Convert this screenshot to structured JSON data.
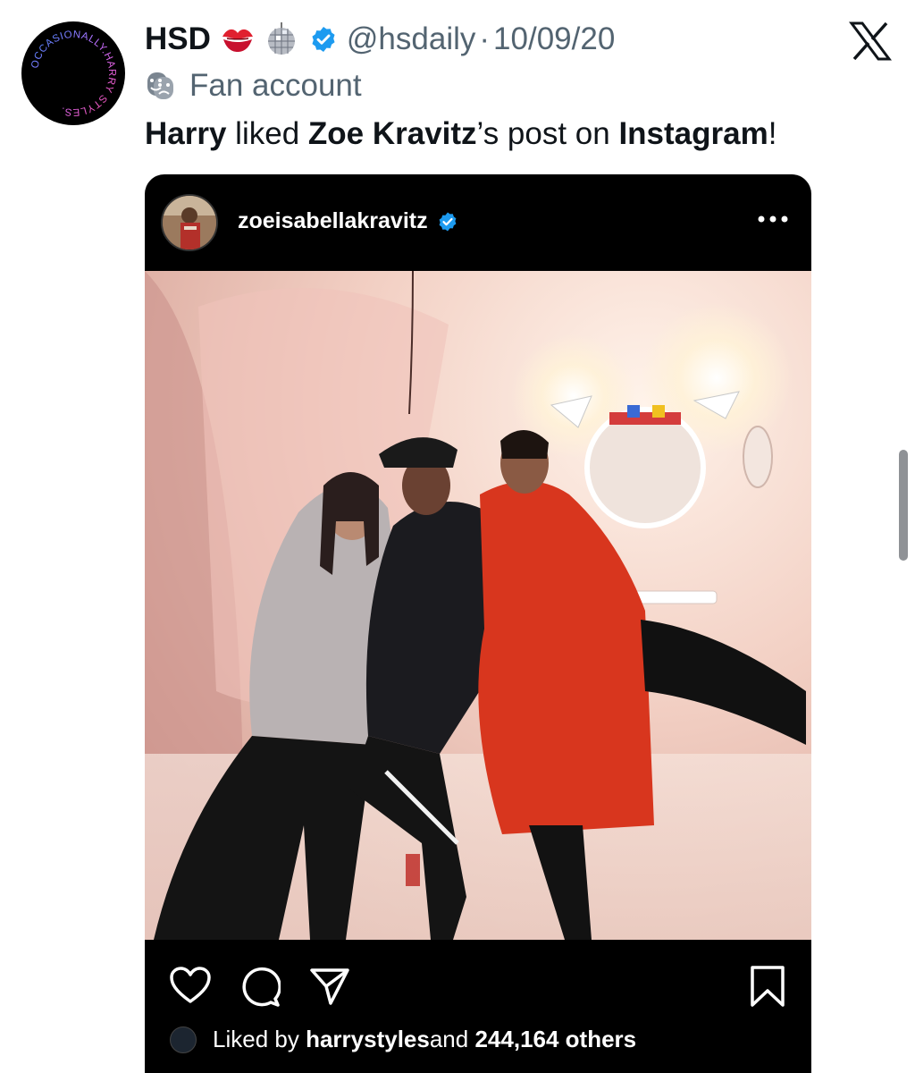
{
  "tweet": {
    "display_name": "HSD",
    "handle": "@hsdaily",
    "separator": "·",
    "date": "10/09/20",
    "label": "Fan account",
    "avatar_text": "OCCASIONALLY.HARRY STYLES.",
    "text": {
      "part1": "Harry",
      "part2": " liked ",
      "part3": "Zoe Kravitz",
      "part4": "’s post on ",
      "part5": "Instagram",
      "part6": "!"
    }
  },
  "instagram_post": {
    "username": "zoeisabellakravitz",
    "likes": {
      "prefix": "Liked by ",
      "user": "harrystyles",
      "middle": " and ",
      "count": "244,164 others"
    }
  },
  "icons": {
    "kiss": "kiss-mark-icon",
    "disco": "disco-ball-icon",
    "verified": "verified-badge-icon",
    "x": "x-logo-icon",
    "mask": "performing-arts-mask-icon",
    "more": "more-options-icon",
    "heart": "heart-icon",
    "comment": "comment-icon",
    "share": "share-icon",
    "save": "bookmark-icon"
  },
  "colors": {
    "accent": "#1d9bf0",
    "secondary_text": "#536471",
    "avatar_text_pink": "#ff4fa3",
    "avatar_text_blue": "#2f8cff"
  }
}
